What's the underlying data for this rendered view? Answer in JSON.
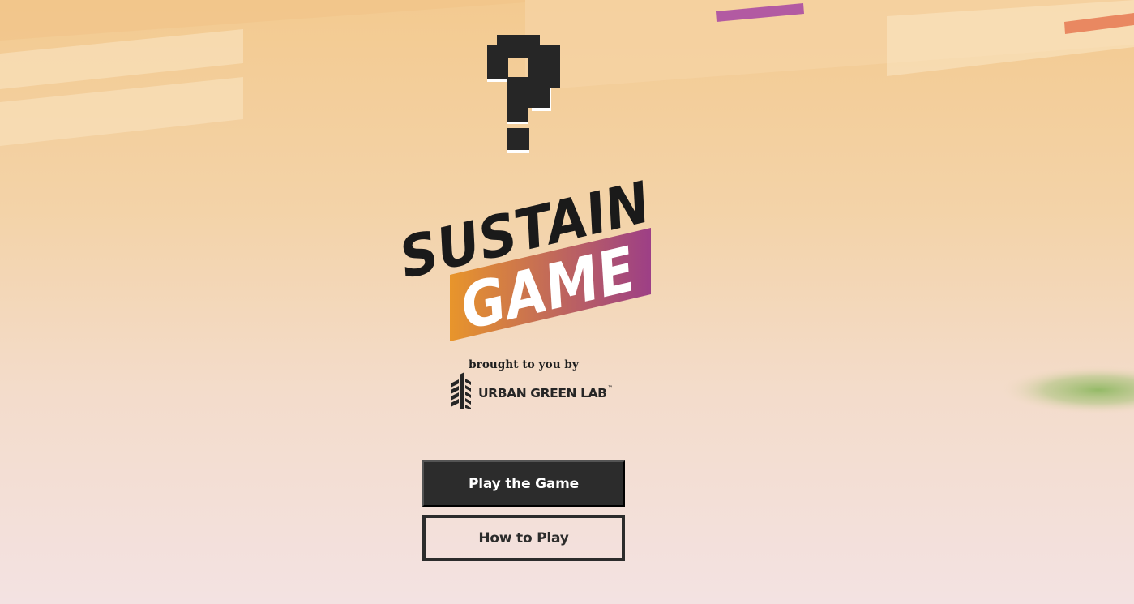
{
  "game": {
    "title_line1": "SUSTAIN",
    "title_line2": "GAME",
    "title_icon": "pixel-question-mark-icon"
  },
  "credit": {
    "text": "brought to you by",
    "partner_name": "URBAN GREEN LAB",
    "partner_mark": "™",
    "partner_icon": "building-icon"
  },
  "menu": {
    "play_label": "Play the Game",
    "how_to_label": "How to Play"
  },
  "colors": {
    "dark": "#2c2c2c",
    "title_gradient_start": "#e8952b",
    "title_gradient_end": "#9d3f86",
    "background_top": "#f3ca90",
    "background_bottom": "#f3e2e2",
    "accent_purple": "#b25aa2",
    "accent_coral": "#e98861",
    "accent_green": "#8fb862"
  }
}
